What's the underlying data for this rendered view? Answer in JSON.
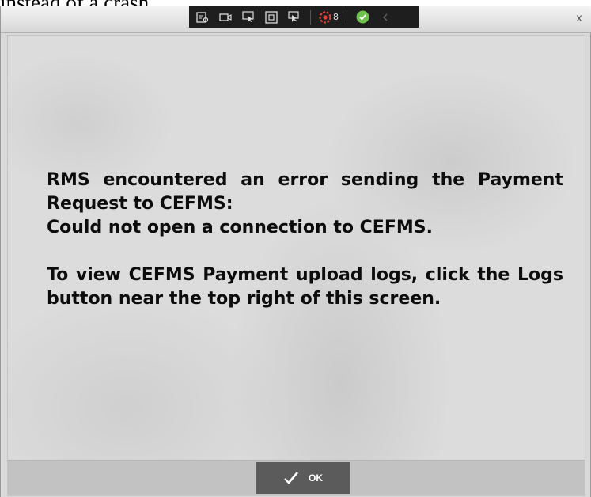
{
  "caption": "instead of a crash.",
  "window": {
    "close_label": "x"
  },
  "toolbar": {
    "items": [
      {
        "name": "screen-capture-icon"
      },
      {
        "name": "record-video-icon"
      },
      {
        "name": "pointer-select-icon"
      },
      {
        "name": "window-select-icon"
      },
      {
        "name": "multi-pointer-icon"
      }
    ],
    "badge_count": "8",
    "colors": {
      "background": "#1e1e1e",
      "badge": "#e0433a",
      "check": "#6cc24a"
    }
  },
  "dialog": {
    "message_lines": [
      "RMS encountered an error sending the Payment Request to CEFMS:",
      "Could not open a connection to CEFMS."
    ],
    "hint": "To view CEFMS Payment upload logs, click the Logs button near the top right of this screen.",
    "ok_label": "OK"
  }
}
